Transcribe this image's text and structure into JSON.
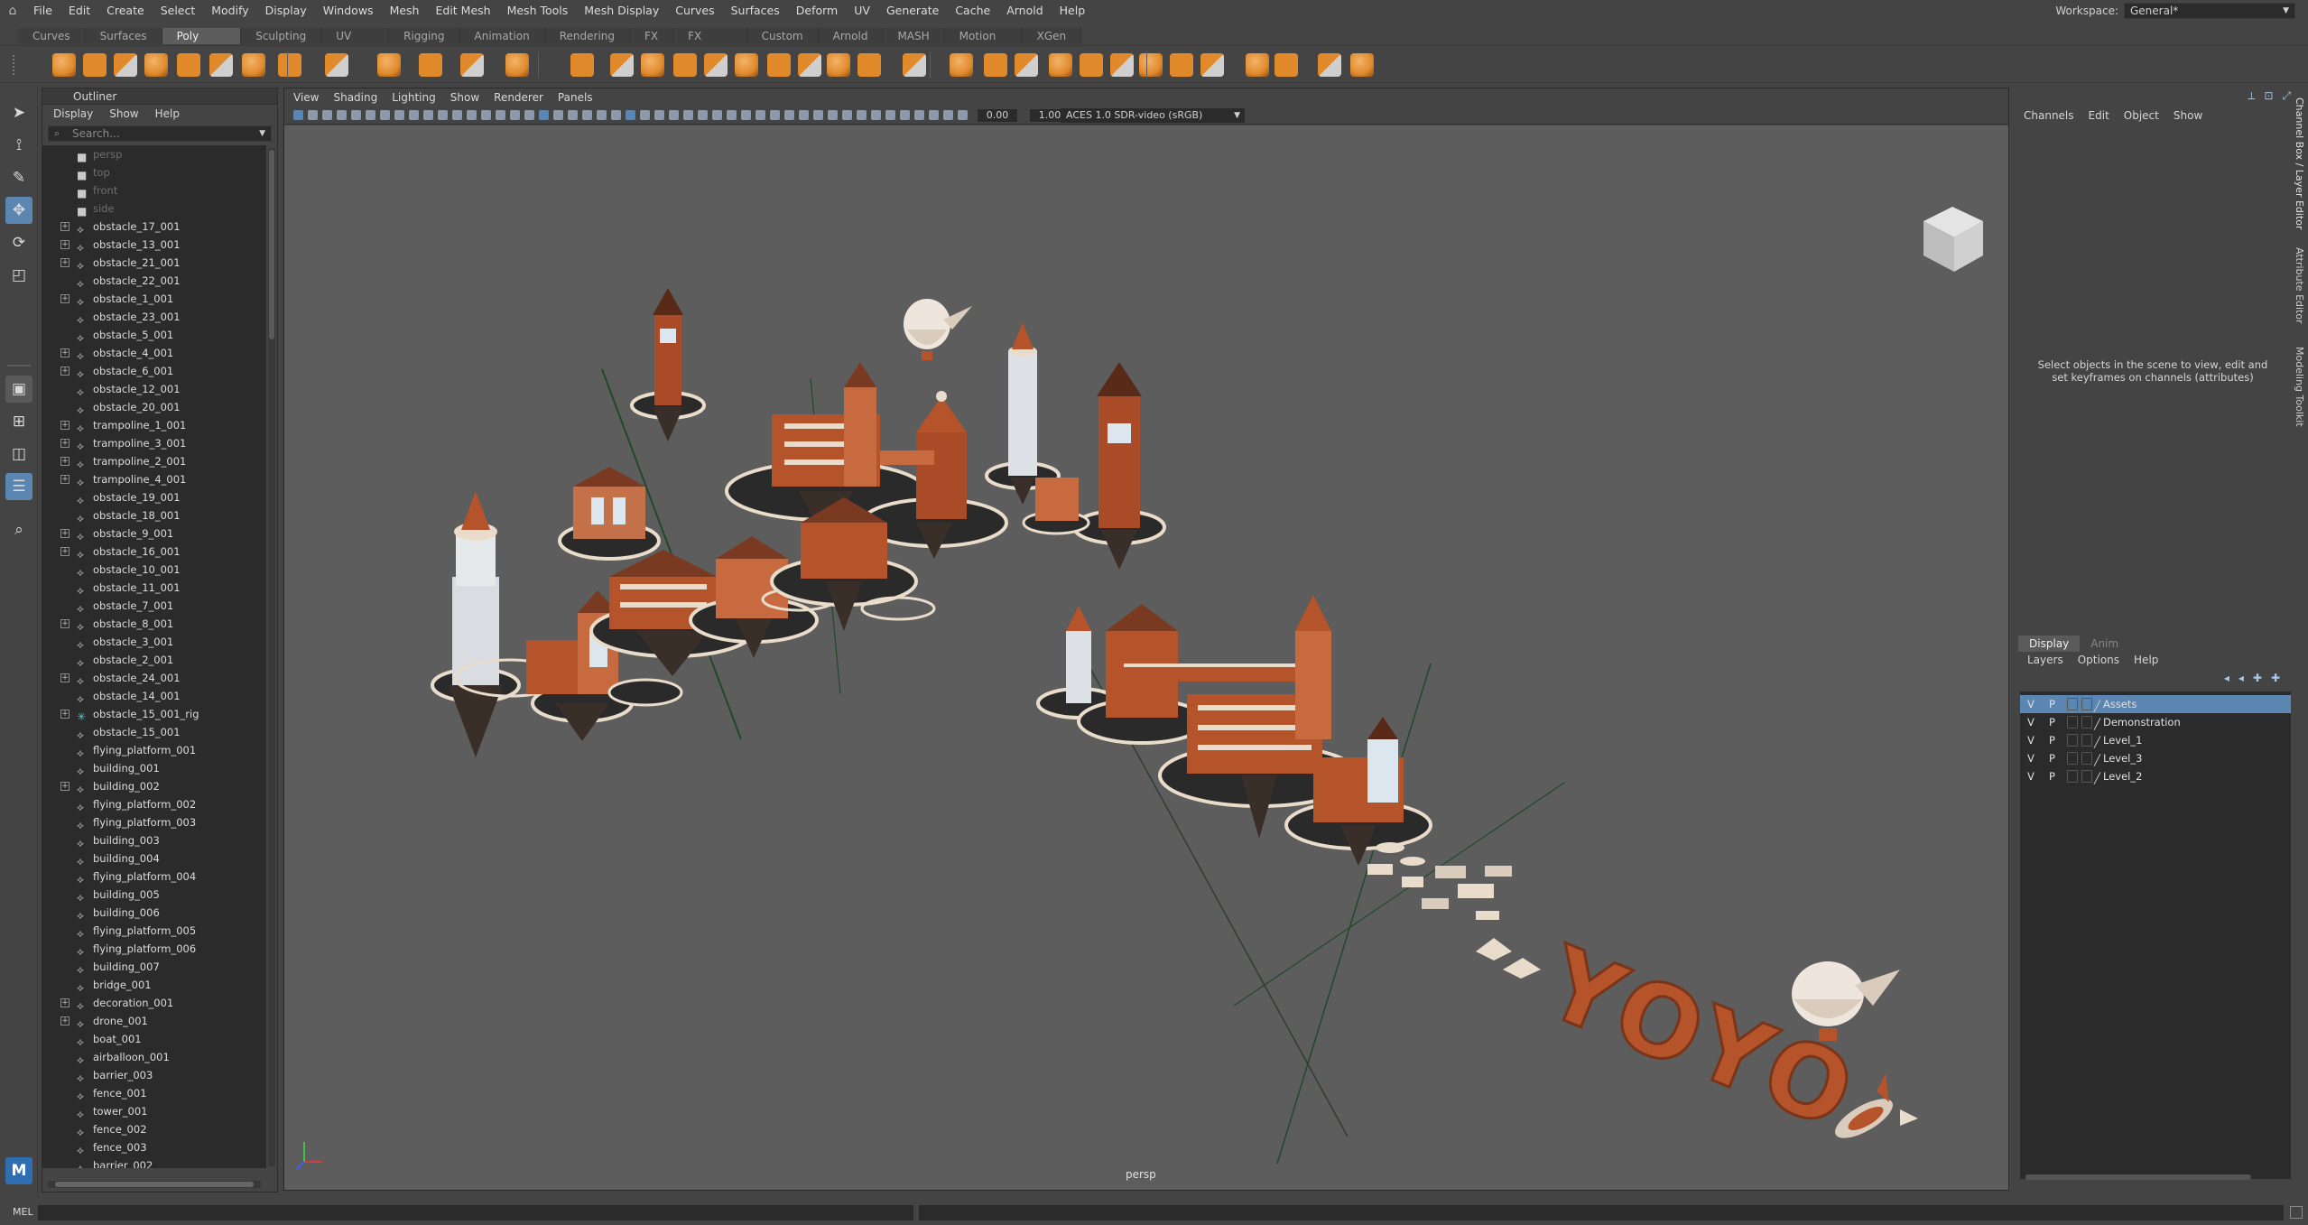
{
  "menubar": {
    "items": [
      "File",
      "Edit",
      "Create",
      "Select",
      "Modify",
      "Display",
      "Windows",
      "Mesh",
      "Edit Mesh",
      "Mesh Tools",
      "Mesh Display",
      "Curves",
      "Surfaces",
      "Deform",
      "UV",
      "Generate",
      "Cache",
      "Arnold",
      "Help"
    ],
    "workspace_label": "Workspace:",
    "workspace_value": "General*"
  },
  "shelf": {
    "tabs": [
      "Curves",
      "Surfaces",
      "Poly Modeling",
      "Sculpting",
      "UV Editing",
      "Rigging",
      "Animation",
      "Rendering",
      "FX",
      "FX Caching",
      "Custom",
      "Arnold",
      "MASH",
      "Motion Graphics",
      "XGen"
    ],
    "active_tab": "Poly Modeling",
    "icon_color": "#e08a2c"
  },
  "outliner": {
    "title": "Outliner",
    "menus": [
      "Display",
      "Show",
      "Help"
    ],
    "search_placeholder": "Search...",
    "items": [
      {
        "name": "persp",
        "type": "camera",
        "expandable": false,
        "dim": true
      },
      {
        "name": "top",
        "type": "camera",
        "expandable": false,
        "dim": true
      },
      {
        "name": "front",
        "type": "camera",
        "expandable": false,
        "dim": true
      },
      {
        "name": "side",
        "type": "camera",
        "expandable": false,
        "dim": true
      },
      {
        "name": "obstacle_17_001",
        "type": "mesh",
        "expandable": true
      },
      {
        "name": "obstacle_13_001",
        "type": "mesh",
        "expandable": true
      },
      {
        "name": "obstacle_21_001",
        "type": "mesh",
        "expandable": true
      },
      {
        "name": "obstacle_22_001",
        "type": "mesh",
        "expandable": false
      },
      {
        "name": "obstacle_1_001",
        "type": "mesh",
        "expandable": true
      },
      {
        "name": "obstacle_23_001",
        "type": "mesh",
        "expandable": false
      },
      {
        "name": "obstacle_5_001",
        "type": "mesh",
        "expandable": false
      },
      {
        "name": "obstacle_4_001",
        "type": "mesh",
        "expandable": true
      },
      {
        "name": "obstacle_6_001",
        "type": "mesh",
        "expandable": true
      },
      {
        "name": "obstacle_12_001",
        "type": "mesh",
        "expandable": false
      },
      {
        "name": "obstacle_20_001",
        "type": "mesh",
        "expandable": false
      },
      {
        "name": "trampoline_1_001",
        "type": "mesh",
        "expandable": true
      },
      {
        "name": "trampoline_3_001",
        "type": "mesh",
        "expandable": true
      },
      {
        "name": "trampoline_2_001",
        "type": "mesh",
        "expandable": true
      },
      {
        "name": "trampoline_4_001",
        "type": "mesh",
        "expandable": true
      },
      {
        "name": "obstacle_19_001",
        "type": "mesh",
        "expandable": false
      },
      {
        "name": "obstacle_18_001",
        "type": "mesh",
        "expandable": false
      },
      {
        "name": "obstacle_9_001",
        "type": "mesh",
        "expandable": true
      },
      {
        "name": "obstacle_16_001",
        "type": "mesh",
        "expandable": true
      },
      {
        "name": "obstacle_10_001",
        "type": "mesh",
        "expandable": false
      },
      {
        "name": "obstacle_11_001",
        "type": "mesh",
        "expandable": false
      },
      {
        "name": "obstacle_7_001",
        "type": "mesh",
        "expandable": false
      },
      {
        "name": "obstacle_8_001",
        "type": "mesh",
        "expandable": true
      },
      {
        "name": "obstacle_3_001",
        "type": "mesh",
        "expandable": false
      },
      {
        "name": "obstacle_2_001",
        "type": "mesh",
        "expandable": false
      },
      {
        "name": "obstacle_24_001",
        "type": "mesh",
        "expandable": true
      },
      {
        "name": "obstacle_14_001",
        "type": "mesh",
        "expandable": false
      },
      {
        "name": "obstacle_15_001_rig",
        "type": "rig",
        "expandable": true
      },
      {
        "name": "obstacle_15_001",
        "type": "mesh",
        "expandable": false
      },
      {
        "name": "flying_platform_001",
        "type": "mesh",
        "expandable": false
      },
      {
        "name": "building_001",
        "type": "mesh",
        "expandable": false
      },
      {
        "name": "building_002",
        "type": "mesh",
        "expandable": true
      },
      {
        "name": "flying_platform_002",
        "type": "mesh",
        "expandable": false
      },
      {
        "name": "flying_platform_003",
        "type": "mesh",
        "expandable": false
      },
      {
        "name": "building_003",
        "type": "mesh",
        "expandable": false
      },
      {
        "name": "building_004",
        "type": "mesh",
        "expandable": false
      },
      {
        "name": "flying_platform_004",
        "type": "mesh",
        "expandable": false
      },
      {
        "name": "building_005",
        "type": "mesh",
        "expandable": false
      },
      {
        "name": "building_006",
        "type": "mesh",
        "expandable": false
      },
      {
        "name": "flying_platform_005",
        "type": "mesh",
        "expandable": false
      },
      {
        "name": "flying_platform_006",
        "type": "mesh",
        "expandable": false
      },
      {
        "name": "building_007",
        "type": "mesh",
        "expandable": false
      },
      {
        "name": "bridge_001",
        "type": "mesh",
        "expandable": false
      },
      {
        "name": "decoration_001",
        "type": "mesh",
        "expandable": true
      },
      {
        "name": "drone_001",
        "type": "mesh",
        "expandable": true
      },
      {
        "name": "boat_001",
        "type": "mesh",
        "expandable": false
      },
      {
        "name": "airballoon_001",
        "type": "mesh",
        "expandable": false
      },
      {
        "name": "barrier_003",
        "type": "mesh",
        "expandable": false
      },
      {
        "name": "fence_001",
        "type": "mesh",
        "expandable": false
      },
      {
        "name": "tower_001",
        "type": "mesh",
        "expandable": false
      },
      {
        "name": "fence_002",
        "type": "mesh",
        "expandable": false
      },
      {
        "name": "fence_003",
        "type": "mesh",
        "expandable": false
      },
      {
        "name": "barrier_002",
        "type": "mesh",
        "expandable": false
      }
    ]
  },
  "viewport": {
    "menus": [
      "View",
      "Shading",
      "Lighting",
      "Show",
      "Renderer",
      "Panels"
    ],
    "exposure": "0.00",
    "gamma": "1.00",
    "color_space": "ACES 1.0 SDR-video (sRGB)",
    "camera_label": "persp",
    "scene_text": "YOYO"
  },
  "channel_box": {
    "menus": [
      "Channels",
      "Edit",
      "Object",
      "Show"
    ],
    "message": "Select objects in the scene to view, edit and set keyframes on channels (attributes)",
    "side_tabs": [
      "Channel Box / Layer Editor",
      "Attribute Editor",
      "Modeling Toolkit"
    ]
  },
  "layer_editor": {
    "tabs": [
      "Display",
      "Anim"
    ],
    "active_tab": "Display",
    "menus": [
      "Layers",
      "Options",
      "Help"
    ],
    "layers": [
      {
        "v": "V",
        "p": "P",
        "name": "Assets",
        "selected": true
      },
      {
        "v": "V",
        "p": "P",
        "name": "Demonstration",
        "selected": false
      },
      {
        "v": "V",
        "p": "P",
        "name": "Level_1",
        "selected": false
      },
      {
        "v": "V",
        "p": "P",
        "name": "Level_3",
        "selected": false
      },
      {
        "v": "V",
        "p": "P",
        "name": "Level_2",
        "selected": false
      }
    ]
  },
  "command_line": {
    "label": "MEL"
  },
  "colors": {
    "accent_blue": "#5b86b1",
    "terracotta": "#b5532a",
    "cream": "#e9dccb",
    "viewport_bg": "#5d5d5d"
  }
}
